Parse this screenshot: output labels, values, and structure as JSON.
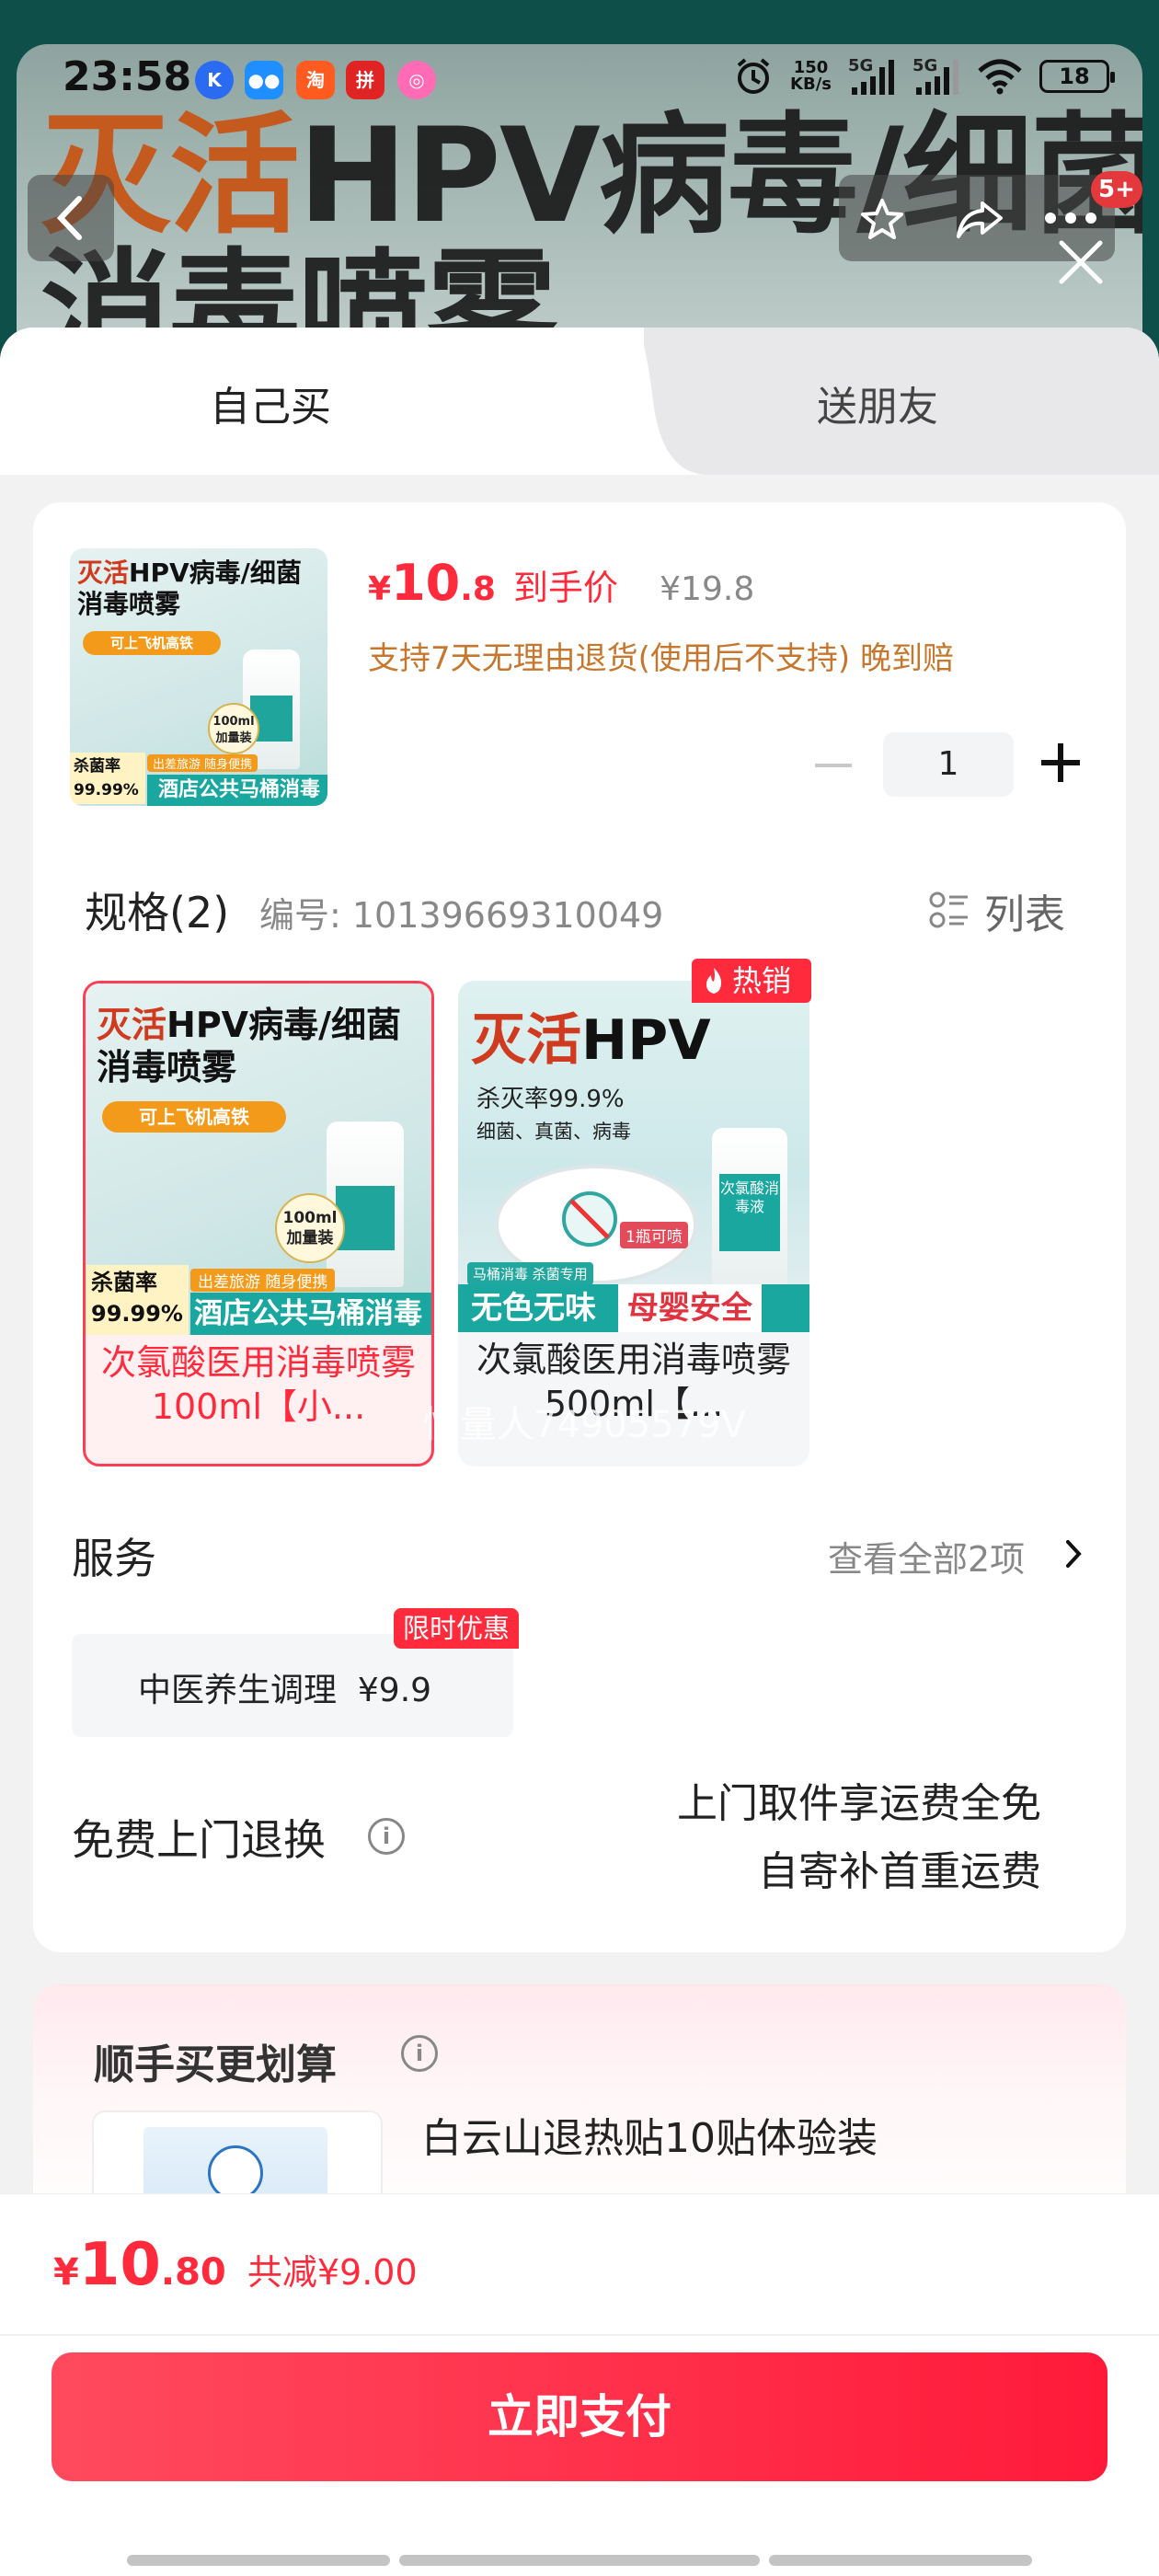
{
  "status_bar": {
    "time": "23:58",
    "net_speed_value": "150",
    "net_speed_unit": "KB/s",
    "signal_1": "5G",
    "signal_2": "5G",
    "battery": "18"
  },
  "hero": {
    "title_highlight": "灭活",
    "title_rest": "HPV病毒/细菌",
    "title_line2": "消毒喷雾",
    "notification_badge": "5+"
  },
  "tabs": [
    {
      "label": "自己买",
      "active": true
    },
    {
      "label": "送朋友",
      "active": false
    }
  ],
  "product": {
    "image": {
      "title_highlight": "灭活",
      "title_rest": "HPV病毒/细菌",
      "title_line2": "消毒喷雾",
      "pill": "可上飞机高铁",
      "size_badge_1": "100ml",
      "size_badge_2": "加量装",
      "kill_label": "杀菌率",
      "kill_value": "99.99%",
      "travel_text": "出差旅游 随身便携",
      "bar_text": "酒店公共马桶消毒"
    },
    "price_symbol": "¥",
    "price_int": "10",
    "price_dec": ".8",
    "price_tag": "到手价",
    "original_price": "¥19.8",
    "policy": "支持7天无理由退货(使用后不支持)  晚到赔",
    "quantity": "1"
  },
  "spec": {
    "title": "规格(2)",
    "code": "编号: 10139669310049",
    "list_label": "列表",
    "hot_badge": "热销",
    "watermark": "慢量人74905579V",
    "options": [
      {
        "name": "次氯酸医用消毒喷雾100ml【小...",
        "selected": true,
        "img_title_highlight": "灭活",
        "img_title_rest": "HPV病毒/细菌",
        "img_title_line2": "消毒喷雾",
        "img_pill": "可上飞机高铁",
        "img_size_1": "100ml",
        "img_size_2": "加量装",
        "img_kill_label": "杀菌率",
        "img_kill_value": "99.99%",
        "img_travel": "出差旅游 随身便携",
        "img_bar": "酒店公共马桶消毒"
      },
      {
        "name": "次氯酸医用消毒喷雾500ml【...",
        "selected": false,
        "img_title_highlight": "灭活",
        "img_title_rest": "HPV",
        "img_line_a": "杀灭率99.9%",
        "img_line_b": "细菌、真菌、病毒",
        "img_tag_a": "1瓶可喷",
        "img_tag_b": "马桶消毒 杀菌专用",
        "img_bottle_label": "次氯酸消毒液",
        "img_bar_left": "无色无味",
        "img_bar_right": "母婴安全"
      }
    ]
  },
  "services": {
    "title": "服务",
    "view_all": "查看全部2项",
    "item_name": "中医养生调理",
    "item_price": "¥9.9",
    "item_tag": "限时优惠"
  },
  "returns": {
    "title": "免费上门退换",
    "line1": "上门取件享运费全免",
    "line2": "自寄补首重运费"
  },
  "addon": {
    "title": "顺手买更划算",
    "item_name": "白云山退热贴10贴体验装"
  },
  "checkout": {
    "symbol": "¥",
    "total_int": "10",
    "total_dec": ".80",
    "savings": "共减¥9.00",
    "pay_label": "立即支付"
  },
  "colors": {
    "accent": "#ff2b3c",
    "teal": "#1aa7a0",
    "policy": "#c7772d"
  }
}
